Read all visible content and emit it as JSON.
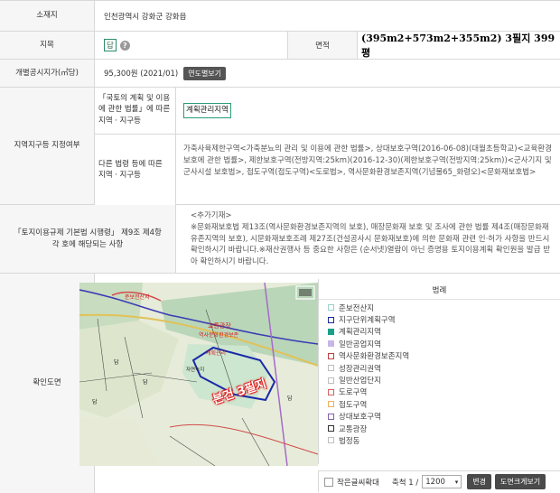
{
  "location": {
    "label": "소재지",
    "value": "인천광역시 강화군 강화읍"
  },
  "landcat": {
    "label": "지목",
    "value": "답",
    "help_icon": "?",
    "area_label": "면적",
    "area_value": "(395m2+573m2+355m2) 3필지 399평"
  },
  "price": {
    "label": "개별공시지가(㎡당)",
    "value": "95,300원 (2021/01)",
    "button": "연도별보기"
  },
  "zoning": {
    "label": "지역지구등 지정여부",
    "national_label": "「국토의 계획 및 이용에 관한 법률」에 따른 지역ㆍ지구등",
    "national_value": "계획관리지역",
    "other_label": "다른 법령 등에 따른 지역ㆍ지구등",
    "other_value": "가축사육제한구역<가축분뇨의 관리 및 이용에 관한 법률>, 상대보호구역(2016-06-08)(대월초등학교)<교육환경 보호에 관한 법률>, 제한보호구역(전방지역:25km)(2016-12-30)(제한보호구역(전방지역:25km))<군사기지 및 군사시설 보호법>, 접도구역(접도구역)<도로법>, 역사문화환경보존지역(기념물65_화령오)<문화재보호법>"
  },
  "regulation": {
    "label": "「토지이용규제 기본법 시행령」 제9조 제4항 각 호에 해당되는 사항",
    "line1": "<추가기재>",
    "text": "※문화재보호법 제13조(역사문화환경보존지역의 보호), 매장문화재 보호 및 조사에 관한 법률 제4조(매장문화재 유존지역의 보호), 시문화재보호조례 제27조(건설공사시 문화재보호)에 의한 문화재 관련 인·허가 사항을 반드시 확인하시기 바랍니다.※재산권행사 등 중요한 사항은 (순서넷)열람이 아닌 증명용 토지이용계획 확인원을 발급 받아 확인하시기 바랍니다."
  },
  "map": {
    "label": "확인도면",
    "stamp_text": "본건 3필지",
    "labels": [
      "교통광장",
      "준보전산지",
      "역사문화환경보존지역",
      "계획관리지역",
      "자연녹지",
      "답"
    ],
    "legend_title": "범례",
    "legend": [
      {
        "label": "준보전산지",
        "color": "#9ad0c8"
      },
      {
        "label": "지구단위계획구역",
        "color": "#1a2a9a"
      },
      {
        "label": "계획관리지역",
        "color": "#1aa08a"
      },
      {
        "label": "일반공업지역",
        "color": "#c9b6e8"
      },
      {
        "label": "역사문화환경보존지역",
        "color": "#d4a8a8"
      },
      {
        "label": "성장관리권역",
        "color": "#e0e0e0"
      },
      {
        "label": "일반산업단지",
        "color": "#e0c8a0"
      },
      {
        "label": "도로구역",
        "color": "#d46060"
      },
      {
        "label": "접도구역",
        "color": "#e8b060"
      },
      {
        "label": "상대보호구역",
        "color": "#8060b0"
      },
      {
        "label": "교통광장",
        "color": "#303030"
      },
      {
        "label": "법정동",
        "color": "#c0c0c0"
      }
    ],
    "bottom": {
      "checkbox_label": "작은글씨확대",
      "scale_label": "축척 1 /",
      "scale_value": "1200",
      "change_button": "변경",
      "large_button": "도면크게보기"
    }
  }
}
